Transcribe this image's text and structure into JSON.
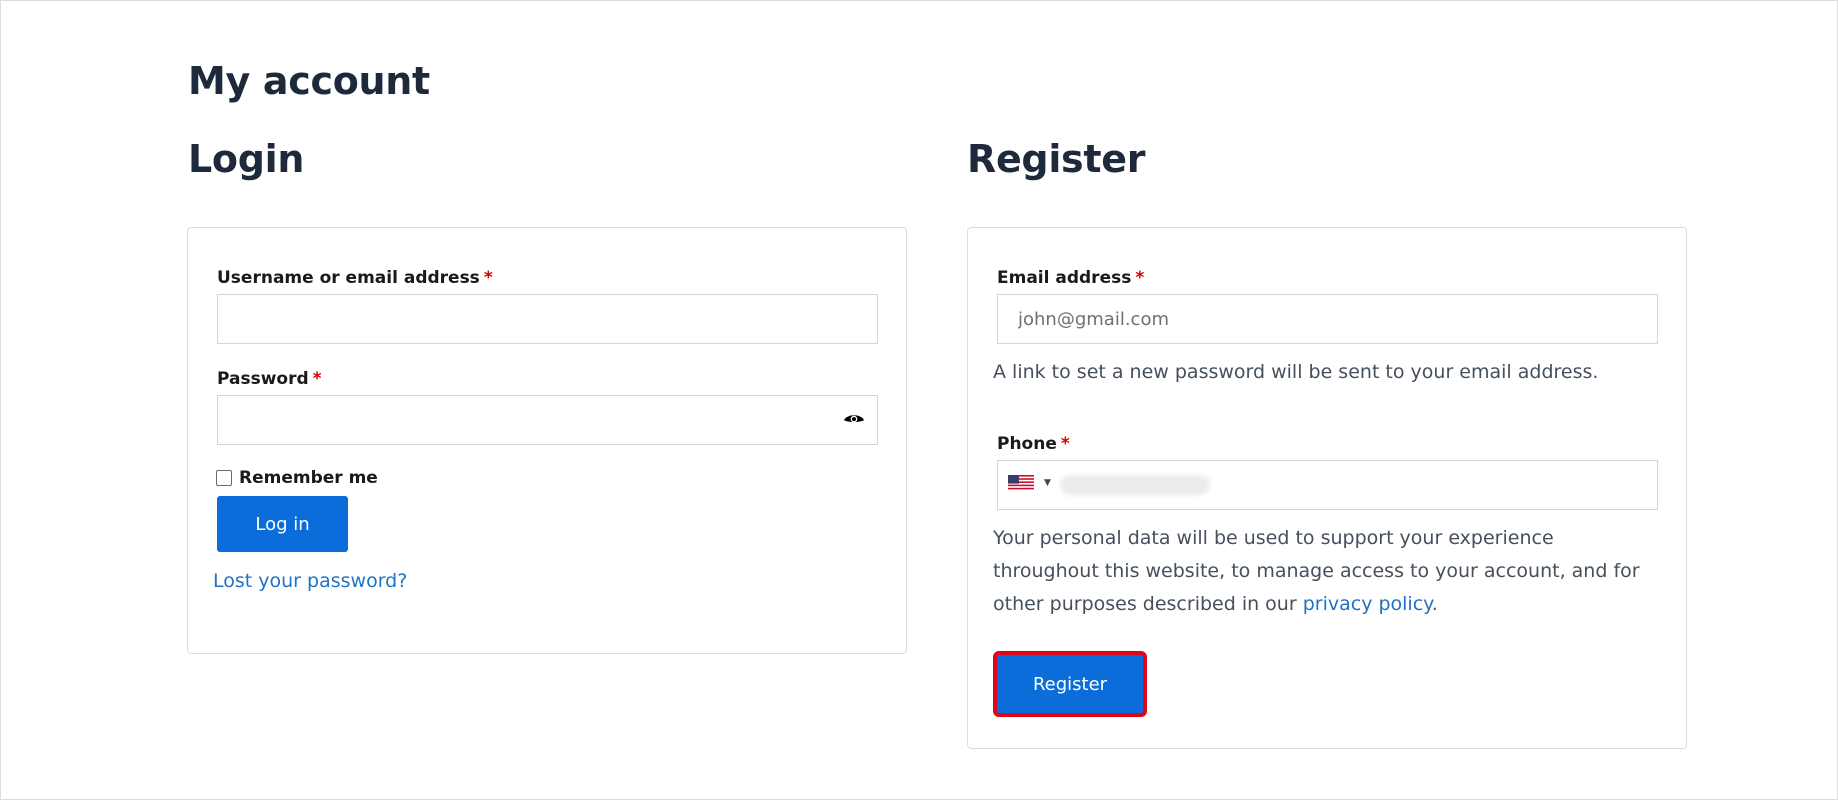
{
  "page": {
    "title": "My account"
  },
  "login": {
    "heading": "Login",
    "username_label": "Username or email address",
    "password_label": "Password",
    "required_mark": "*",
    "username_value": "",
    "password_value": "",
    "remember_label": "Remember me",
    "remember_checked": false,
    "submit_label": "Log in",
    "lost_password_link": "Lost your password?"
  },
  "register": {
    "heading": "Register",
    "email_label": "Email address",
    "email_placeholder": "john@gmail.com",
    "email_help": "A link to set a new password will be sent to your email address.",
    "phone_label": "Phone",
    "phone_country": "US",
    "privacy_text_before": "Your personal data will be used to support your experience throughout this website, to manage access to your account, and for other purposes described in our ",
    "privacy_link": "privacy policy",
    "privacy_text_after": ".",
    "submit_label": "Register"
  },
  "colors": {
    "accent": "#0a6dd9",
    "link": "#1f72c4",
    "required": "#d40000",
    "highlight": "#e0061a",
    "heading": "#1e2a3b"
  },
  "icons": {
    "password_toggle": "eye-icon",
    "country_flag": "us-flag-icon",
    "country_dropdown": "caret-down-icon"
  }
}
